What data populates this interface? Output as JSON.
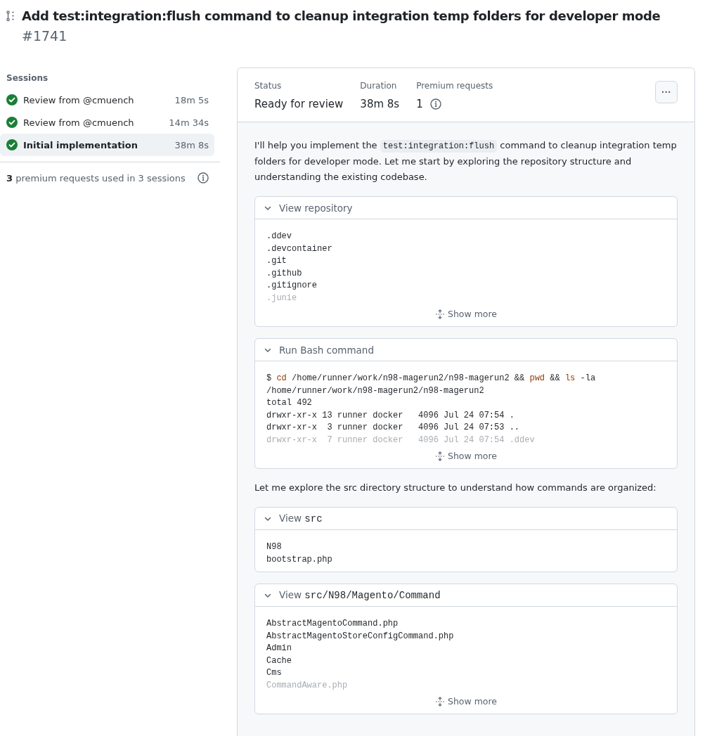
{
  "header": {
    "title": "Add test:integration:flush command to cleanup integration temp folders for developer mode",
    "number": "#1741"
  },
  "sidebar": {
    "heading": "Sessions",
    "items": [
      {
        "label": "Review from @cmuench",
        "duration": "18m 5s",
        "selected": false
      },
      {
        "label": "Review from @cmuench",
        "duration": "14m 34s",
        "selected": false
      },
      {
        "label": "Initial implementation",
        "duration": "38m 8s",
        "selected": true
      }
    ],
    "usage": {
      "count": "3",
      "text": "premium requests used in 3 sessions"
    }
  },
  "summary": {
    "fields": [
      {
        "label": "Status",
        "value": "Ready for review",
        "info": false
      },
      {
        "label": "Duration",
        "value": "38m 8s",
        "info": false
      },
      {
        "label": "Premium requests",
        "value": "1",
        "info": true
      }
    ],
    "menu_button": "···"
  },
  "log": [
    {
      "kind": "text",
      "parts": [
        {
          "text": "I'll help you implement the ",
          "code": false
        },
        {
          "text": "test:integration:flush",
          "code": true
        },
        {
          "text": " command to cleanup integration temp folders for developer mode. Let me start by exploring the repository structure and understanding the existing codebase.",
          "code": false
        }
      ]
    },
    {
      "kind": "tool",
      "title": [
        {
          "text": "View repository",
          "code": false
        }
      ],
      "expanded": true,
      "lines": [
        {
          "faded": false,
          "tokens": [
            {
              "text": ".ddev",
              "cmd": false
            }
          ]
        },
        {
          "faded": false,
          "tokens": [
            {
              "text": ".devcontainer",
              "cmd": false
            }
          ]
        },
        {
          "faded": false,
          "tokens": [
            {
              "text": ".git",
              "cmd": false
            }
          ]
        },
        {
          "faded": false,
          "tokens": [
            {
              "text": ".github",
              "cmd": false
            }
          ]
        },
        {
          "faded": false,
          "tokens": [
            {
              "text": ".gitignore",
              "cmd": false
            }
          ]
        },
        {
          "faded": true,
          "tokens": [
            {
              "text": ".junie",
              "cmd": false
            }
          ]
        }
      ],
      "more": "Show more"
    },
    {
      "kind": "tool",
      "title": [
        {
          "text": "Run Bash command",
          "code": false
        }
      ],
      "expanded": true,
      "lines": [
        {
          "faded": false,
          "tokens": [
            {
              "text": "$ ",
              "cmd": false
            },
            {
              "text": "cd",
              "cmd": true
            },
            {
              "text": " /home/runner/work/n98-magerun2/n98-magerun2 && ",
              "cmd": false
            },
            {
              "text": "pwd",
              "cmd": true
            },
            {
              "text": " && ",
              "cmd": false
            },
            {
              "text": "ls",
              "cmd": true
            },
            {
              "text": " -la",
              "cmd": false
            }
          ]
        },
        {
          "faded": false,
          "tokens": [
            {
              "text": "/home/runner/work/n98-magerun2/n98-magerun2",
              "cmd": false
            }
          ]
        },
        {
          "faded": false,
          "tokens": [
            {
              "text": "total 492",
              "cmd": false
            }
          ]
        },
        {
          "faded": false,
          "tokens": [
            {
              "text": "drwxr-xr-x 13 runner docker   4096 Jul 24 07:54 .",
              "cmd": false
            }
          ]
        },
        {
          "faded": false,
          "tokens": [
            {
              "text": "drwxr-xr-x  3 runner docker   4096 Jul 24 07:53 ..",
              "cmd": false
            }
          ]
        },
        {
          "faded": true,
          "tokens": [
            {
              "text": "drwxr-xr-x  7 runner docker   4096 Jul 24 07:54 .ddev",
              "cmd": false
            }
          ]
        }
      ],
      "more": "Show more"
    },
    {
      "kind": "text",
      "parts": [
        {
          "text": "Let me explore the src directory structure to understand how commands are organized:",
          "code": false
        }
      ]
    },
    {
      "kind": "tool",
      "title": [
        {
          "text": "View ",
          "code": false
        },
        {
          "text": "src",
          "code": true
        }
      ],
      "expanded": true,
      "lines": [
        {
          "faded": false,
          "tokens": [
            {
              "text": "N98",
              "cmd": false
            }
          ]
        },
        {
          "faded": false,
          "tokens": [
            {
              "text": "bootstrap.php",
              "cmd": false
            }
          ]
        }
      ]
    },
    {
      "kind": "tool",
      "title": [
        {
          "text": "View ",
          "code": false
        },
        {
          "text": "src/N98/Magento/Command",
          "code": true
        }
      ],
      "expanded": true,
      "lines": [
        {
          "faded": false,
          "tokens": [
            {
              "text": "AbstractMagentoCommand.php",
              "cmd": false
            }
          ]
        },
        {
          "faded": false,
          "tokens": [
            {
              "text": "AbstractMagentoStoreConfigCommand.php",
              "cmd": false
            }
          ]
        },
        {
          "faded": false,
          "tokens": [
            {
              "text": "Admin",
              "cmd": false
            }
          ]
        },
        {
          "faded": false,
          "tokens": [
            {
              "text": "Cache",
              "cmd": false
            }
          ]
        },
        {
          "faded": false,
          "tokens": [
            {
              "text": "Cms",
              "cmd": false
            }
          ]
        },
        {
          "faded": true,
          "tokens": [
            {
              "text": "CommandAware.php",
              "cmd": false
            }
          ]
        }
      ],
      "more": "Show more"
    }
  ]
}
